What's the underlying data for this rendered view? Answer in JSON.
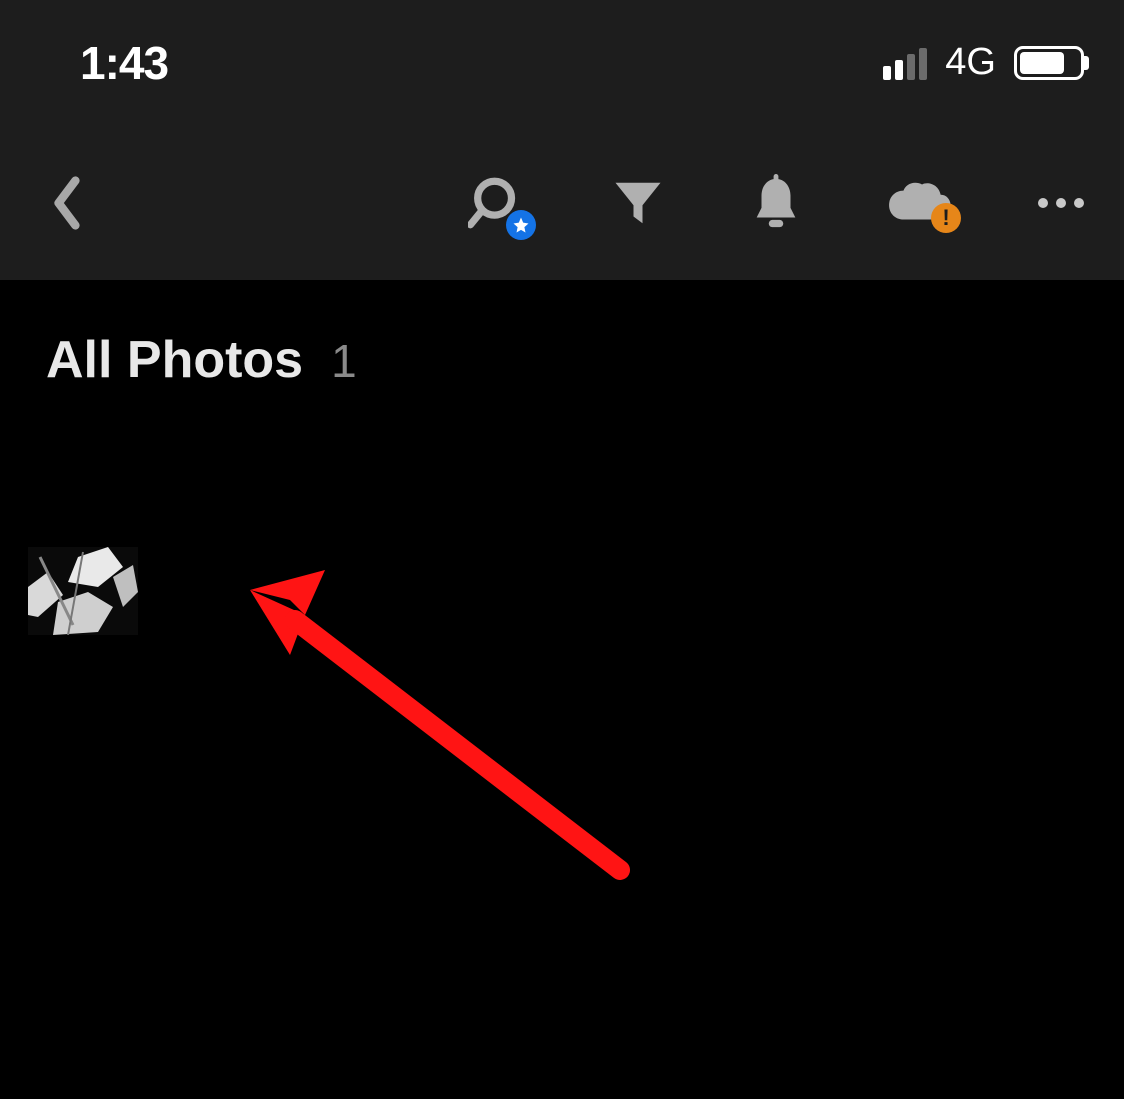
{
  "status": {
    "time": "1:43",
    "network": "4G"
  },
  "section": {
    "title": "All Photos",
    "count": "1"
  },
  "colors": {
    "accent_blue": "#1473e6",
    "accent_orange": "#e68619",
    "bg_toolbar": "#1d1d1d"
  }
}
